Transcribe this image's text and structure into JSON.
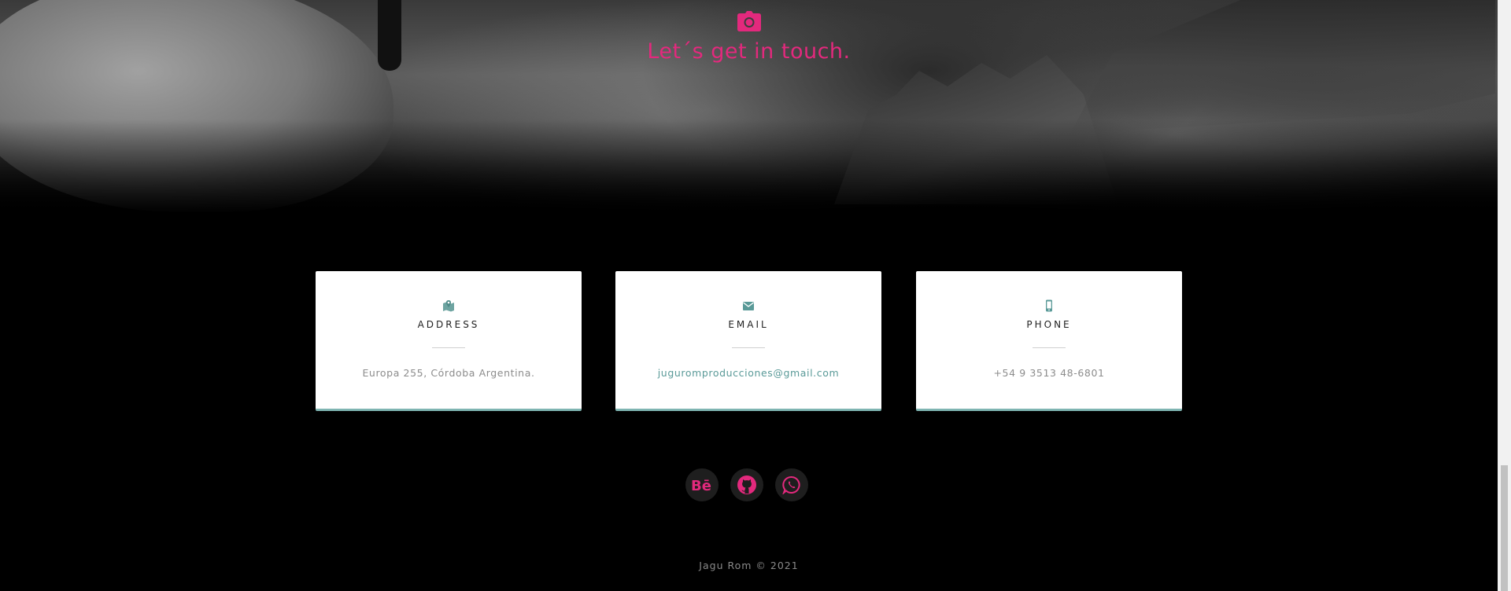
{
  "hero": {
    "icon": "camera-icon",
    "title": "Let´s get in touch."
  },
  "contact_cards": [
    {
      "icon": "map-marker-icon",
      "title": "ADDRESS",
      "value": "Europa 255, Córdoba Argentina."
    },
    {
      "icon": "envelope-icon",
      "title": "EMAIL",
      "value": "juguromproducciones@gmail.com"
    },
    {
      "icon": "mobile-phone-icon",
      "title": "PHONE",
      "value": "+54 9 3513 48-6801"
    }
  ],
  "social_links": [
    {
      "icon": "behance-icon",
      "label": "Behance"
    },
    {
      "icon": "github-icon",
      "label": "GitHub"
    },
    {
      "icon": "whatsapp-icon",
      "label": "WhatsApp"
    }
  ],
  "footer": {
    "copyright": "Jagu Rom © 2021"
  },
  "colors": {
    "accent": "#e3297d",
    "card_accent": "#7fb5b2",
    "background": "#000000"
  }
}
